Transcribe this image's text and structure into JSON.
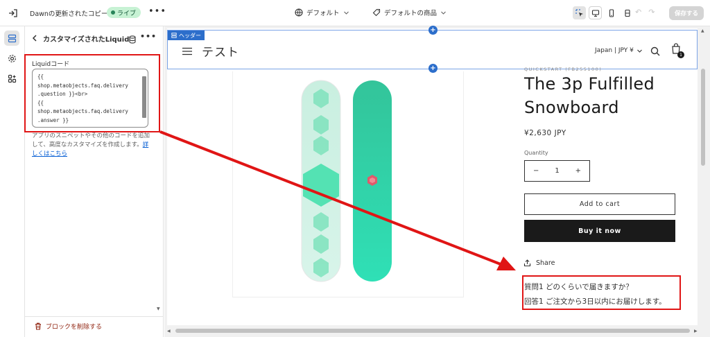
{
  "topbar": {
    "theme_name": "Dawnの更新されたコピー",
    "live_label": "ライブ",
    "more_label": "•••",
    "default_label": "デフォルト",
    "default_product_label": "デフォルトの商品",
    "save_label": "保存する"
  },
  "panel": {
    "title": "カスタマイズされたLiquid",
    "more_label": "•••",
    "code_label": "Liquidコード",
    "code_value": "{{\nshop.metaobjects.faq.delivery\n.question }}<br>\n{{\nshop.metaobjects.faq.delivery\n.answer }}",
    "help_text": "アプリのスニペットやその他のコードを追加して、高度なカスタマイズを作成します。",
    "help_link": "詳しくはこちら",
    "delete_label": "ブロックを削除する"
  },
  "store": {
    "header_tag": "ヘッダー",
    "name": "テスト",
    "locale": "Japan | JPY ¥",
    "cart_count": "1"
  },
  "product": {
    "vendor": "QUICKSTART (FB255100)",
    "title": "The 3p Fulfilled Snowboard",
    "price": "¥2,630 JPY",
    "quantity_label": "Quantity",
    "quantity_value": "1",
    "minus": "−",
    "plus": "+",
    "add_to_cart": "Add to cart",
    "buy_now": "Buy it now",
    "share": "Share",
    "faq_question": "質問1 どのくらいで届きますか？",
    "faq_answer": "回答1 ご注文から3日以内にお届けします。"
  },
  "colors": {
    "highlight": "#e01515",
    "accent": "#2c6ecb",
    "live_badge": "#c7f2d4"
  }
}
